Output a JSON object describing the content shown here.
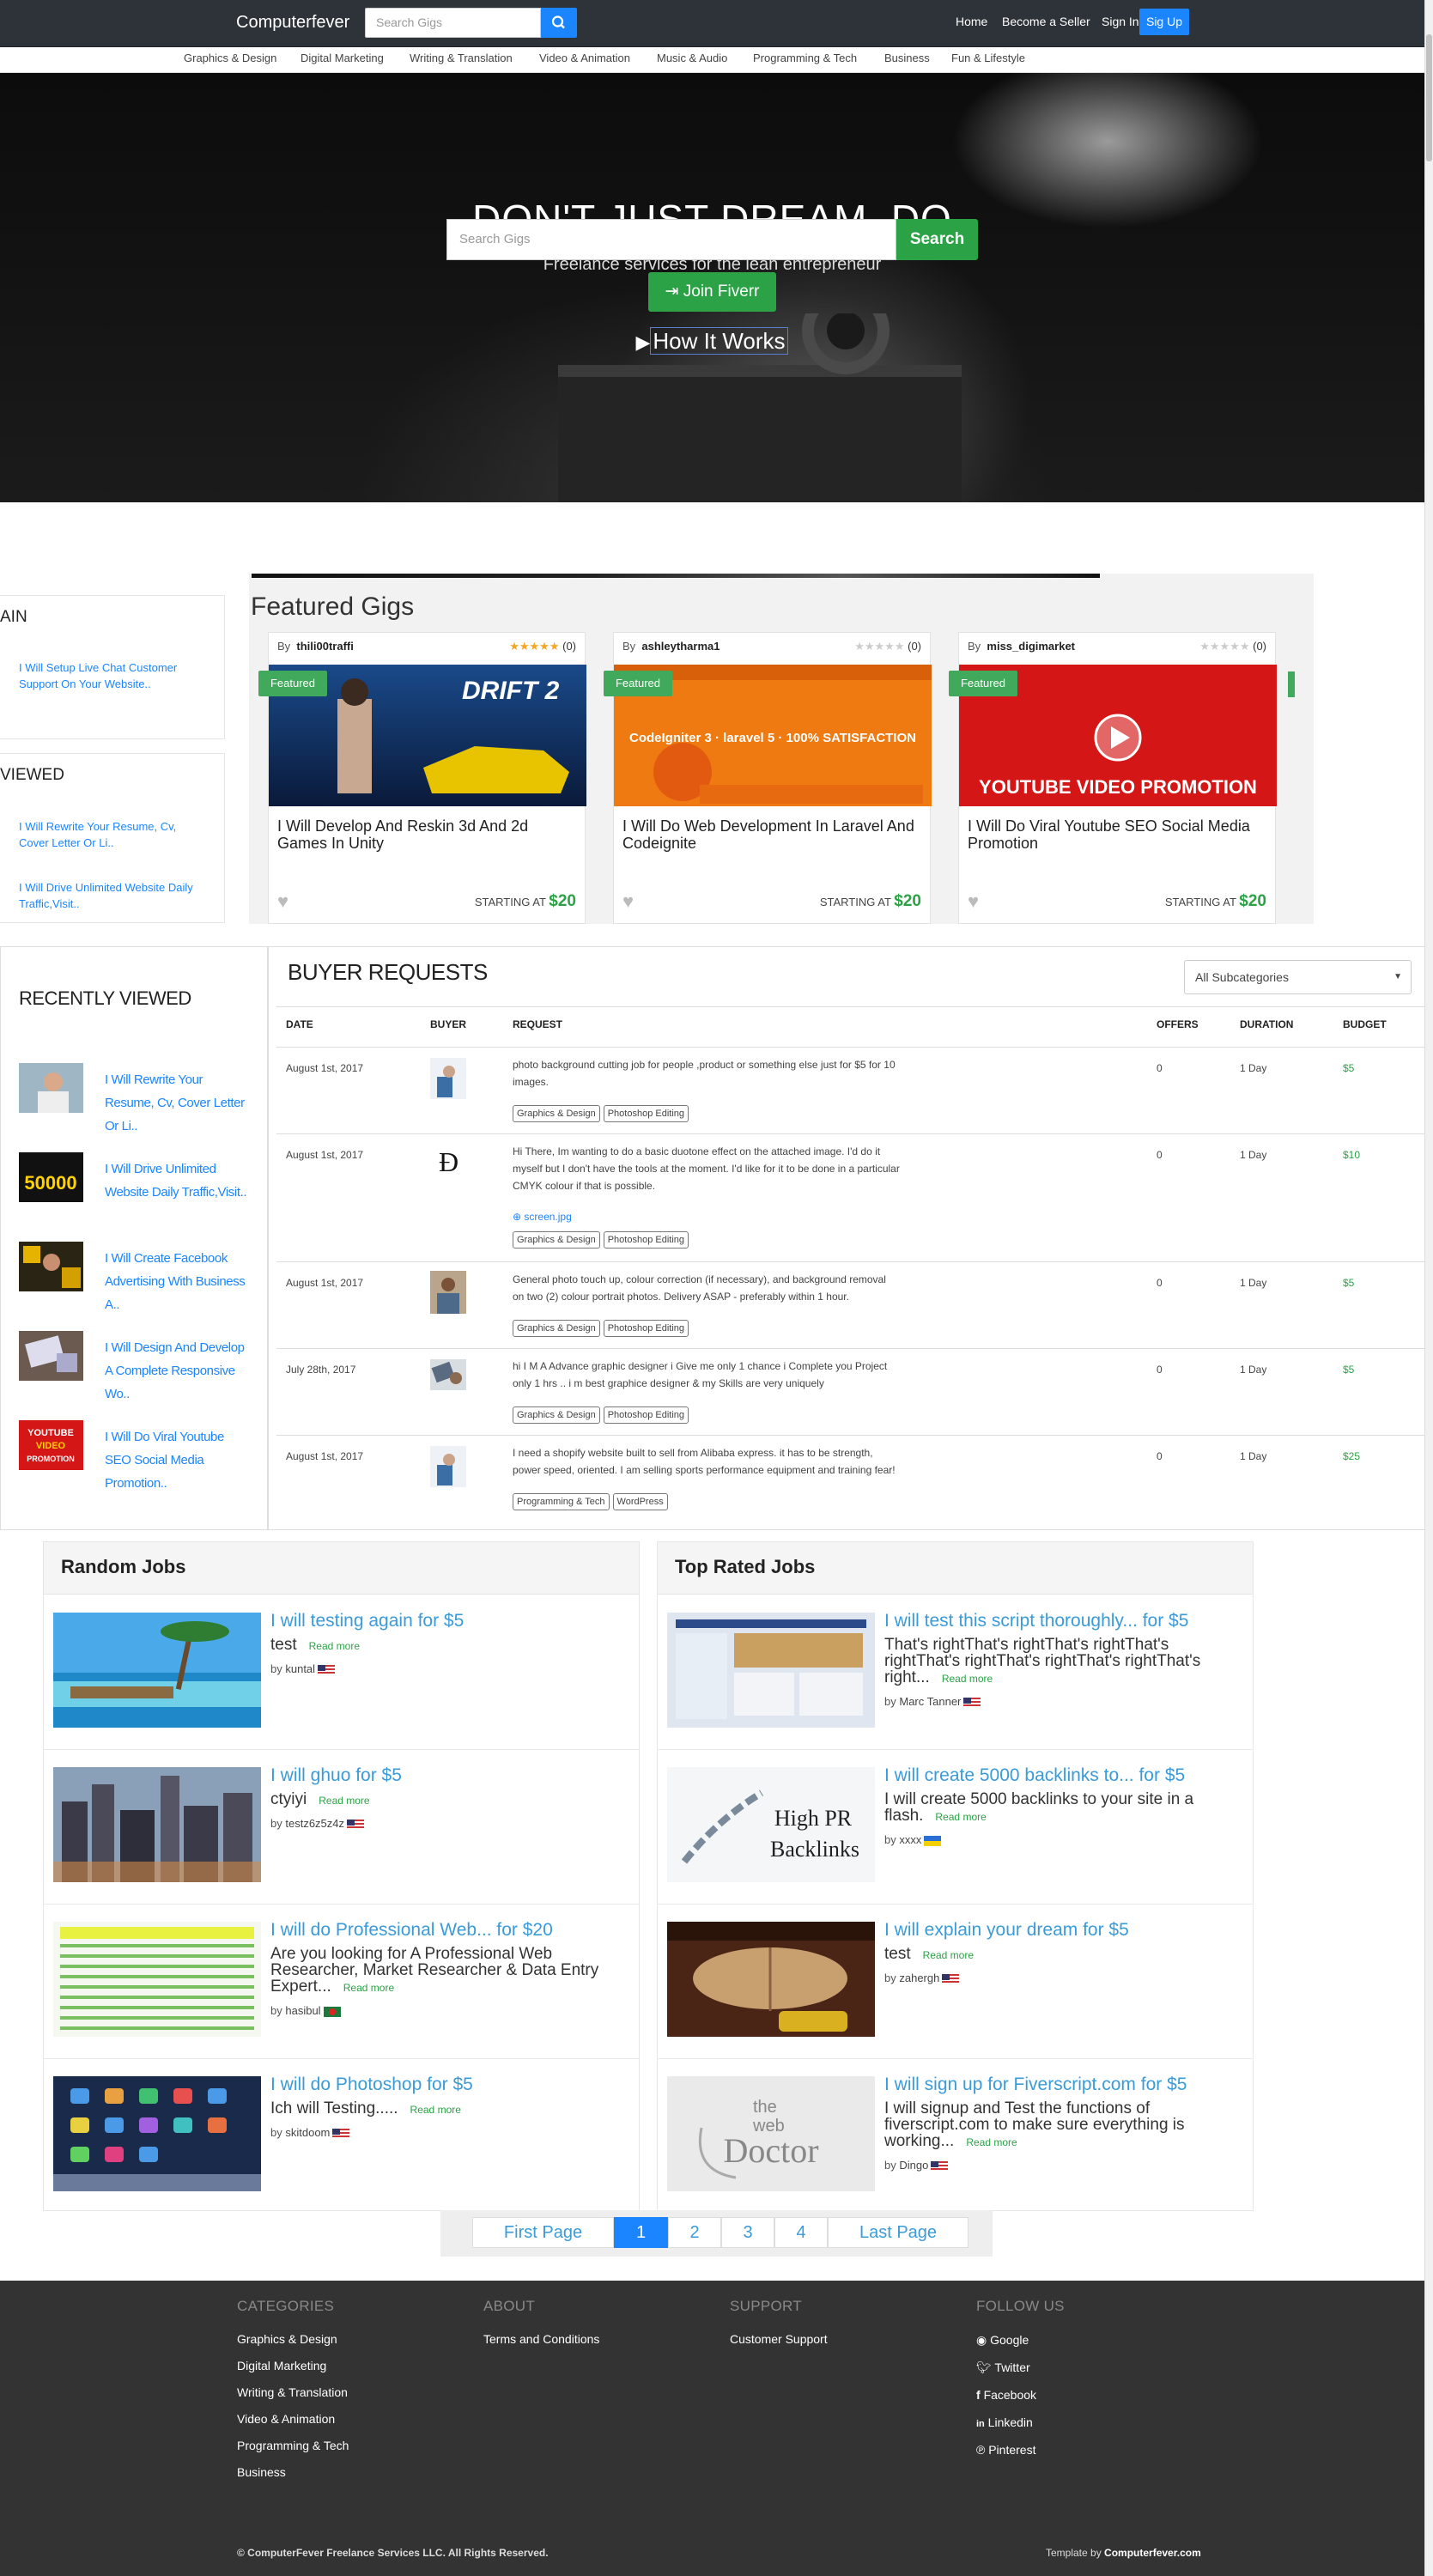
{
  "nav": {
    "brand": "Computerfever",
    "search_placeholder": "Search Gigs",
    "links": [
      "Home",
      "Become a Seller",
      "Sign In"
    ],
    "signup": "Sig Up"
  },
  "categories": [
    "Graphics & Design",
    "Digital Marketing",
    "Writing & Translation",
    "Video & Animation",
    "Music & Audio",
    "Programming & Tech",
    "Business",
    "Fun & Lifestyle"
  ],
  "hero": {
    "title": "DON'T JUST DREAM, DO",
    "subtitle": "Freelance services for the lean entrepreneur",
    "search_placeholder": "Search Gigs",
    "search_btn": "Search",
    "join": "Join Fiverr",
    "how": "How It Works"
  },
  "side_boxes": [
    {
      "heading": "AIN",
      "links": [
        "I Will Setup Live Chat Customer Support On Your Website.."
      ]
    },
    {
      "heading": "VIEWED",
      "links": [
        "I Will Rewrite Your Resume, Cv, Cover Letter Or Li..",
        "I Will Drive Unlimited Website Daily Traffic,Visit.."
      ]
    }
  ],
  "featured": {
    "title": "Featured Gigs",
    "tag": "Featured",
    "starting": "STARTING AT",
    "gigs": [
      {
        "by": "By",
        "user": "thili00traffi",
        "rating": 5,
        "count": "(0)",
        "title": "I Will Develop And Reskin 3d And 2d Games In Unity",
        "price": "$20",
        "img_text": "DRIFT 2"
      },
      {
        "by": "By",
        "user": "ashleytharma1",
        "rating": 0,
        "count": "(0)",
        "title": "I Will Do Web Development In Laravel And Codeignite",
        "price": "$20",
        "img_text": "CodeIgniter 3 · laravel 5 · 100% SATISFACTION"
      },
      {
        "by": "By",
        "user": "miss_digimarket",
        "rating": 0,
        "count": "(0)",
        "title": "I Will Do Viral Youtube SEO Social Media Promotion",
        "price": "$20",
        "img_text": "YOUTUBE VIDEO PROMOTION"
      }
    ]
  },
  "recently_viewed": {
    "title": "RECENTLY VIEWED",
    "items": [
      "I Will Rewrite Your Resume, Cv, Cover Letter Or Li..",
      "I Will Drive Unlimited Website Daily Traffic,Visit..",
      "I Will Create Facebook Advertising With Business A..",
      "I Will Design And Develop A Complete Responsive Wo..",
      "I Will Do Viral Youtube SEO Social Media Promotion.."
    ]
  },
  "buyer_requests": {
    "title": "BUYER REQUESTS",
    "select": "All Subcategories",
    "headers": [
      "DATE",
      "BUYER",
      "REQUEST",
      "OFFERS",
      "DURATION",
      "BUDGET"
    ],
    "rows": [
      {
        "date": "August 1st, 2017",
        "request": "photo background cutting job for people ,product or something else just for $5 for 10 images.",
        "attachment": "",
        "tags": [
          "Graphics & Design",
          "Photoshop Editing"
        ],
        "offers": "0",
        "duration": "1 Day",
        "budget": "$5"
      },
      {
        "date": "August 1st, 2017",
        "request": "Hi There, Im wanting to do a basic duotone effect on the attached image. I'd do it myself but I don't have the tools at the moment. I'd like for it to be done in a particular CMYK colour if that is possible.",
        "attachment": "screen.jpg",
        "tags": [
          "Graphics & Design",
          "Photoshop Editing"
        ],
        "offers": "0",
        "duration": "1 Day",
        "budget": "$10"
      },
      {
        "date": "August 1st, 2017",
        "request": "General photo touch up, colour correction (if necessary), and background removal on two (2) colour portrait photos. Delivery ASAP - preferably within 1 hour.",
        "attachment": "",
        "tags": [
          "Graphics & Design",
          "Photoshop Editing"
        ],
        "offers": "0",
        "duration": "1 Day",
        "budget": "$5"
      },
      {
        "date": "July 28th, 2017",
        "request": "hi I M A Advance graphic designer i Give me only 1 chance i Complete you Project only 1 hrs .. i m best graphice designer & my Skills are very uniquely",
        "attachment": "",
        "tags": [
          "Graphics & Design",
          "Photoshop Editing"
        ],
        "offers": "0",
        "duration": "1 Day",
        "budget": "$5"
      },
      {
        "date": "August 1st, 2017",
        "request": "I need a shopify website built to sell from Alibaba express. it has to be strength, power speed, oriented. I am selling sports performance equipment and training fear!",
        "attachment": "",
        "tags": [
          "Programming & Tech",
          "WordPress"
        ],
        "offers": "0",
        "duration": "1 Day",
        "budget": "$25"
      }
    ]
  },
  "random_jobs": {
    "title": "Random Jobs",
    "read_more": "Read more",
    "by": "by",
    "items": [
      {
        "title": "I will testing again for $5",
        "desc": "test",
        "user": "kuntal",
        "flag": "us"
      },
      {
        "title": "I will ghuo for $5",
        "desc": "ctyiyi",
        "user": "testz6z5z4z",
        "flag": "us"
      },
      {
        "title": "I will do Professional Web... for $20",
        "desc": "Are you looking for A Professional Web Researcher, Market Researcher & Data Entry Expert...",
        "user": "hasibul",
        "flag": "bd"
      },
      {
        "title": "I will do Photoshop for $5",
        "desc": "Ich will Testing.....",
        "user": "skitdoom",
        "flag": "us"
      }
    ]
  },
  "top_jobs": {
    "title": "Top Rated Jobs",
    "items": [
      {
        "title": "I will test this script thoroughly... for $5",
        "desc": "That's rightThat's rightThat's rightThat's rightThat's rightThat's rightThat's rightThat's right...",
        "user": "Marc Tanner",
        "flag": "us"
      },
      {
        "title": "I will create 5000 backlinks to... for $5",
        "desc": "I will create 5000 backlinks to your site in a flash.",
        "user": "xxxx",
        "flag": "ua",
        "img_text": "High PR Backlinks"
      },
      {
        "title": "I will explain your dream for $5",
        "desc": "test",
        "user": "zahergh",
        "flag": "us"
      },
      {
        "title": "I will sign up for Fiverscript.com for $5",
        "desc": "I will signup and Test the functions of fiverscript.com to make sure everything is working...",
        "user": "Dingo",
        "flag": "us",
        "img_text": "the web Doctor"
      }
    ]
  },
  "pager": [
    "First Page",
    "1",
    "2",
    "3",
    "4",
    "Last Page"
  ],
  "footer": {
    "categories": {
      "title": "CATEGORIES",
      "links": [
        "Graphics & Design",
        "Digital Marketing",
        "Writing & Translation",
        "Video & Animation",
        "Programming & Tech",
        "Business"
      ]
    },
    "about": {
      "title": "ABOUT",
      "links": [
        "Terms and Conditions"
      ]
    },
    "support": {
      "title": "SUPPORT",
      "links": [
        "Customer Support"
      ]
    },
    "follow": {
      "title": "FOLLOW US",
      "links": [
        "Google",
        "Twitter",
        "Facebook",
        "Linkedin",
        "Pinterest"
      ]
    },
    "copyright": "© ComputerFever Freelance Services LLC. All Rights Reserved.",
    "template_by": "Template by",
    "template_site": "Computerfever.com"
  }
}
